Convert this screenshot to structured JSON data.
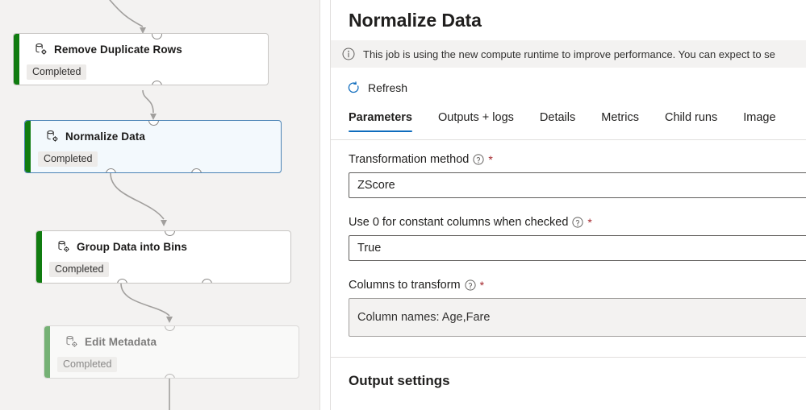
{
  "canvas": {
    "nodes": [
      {
        "id": "remove-duplicate-rows",
        "title": "Remove Duplicate Rows",
        "status": "Completed",
        "icon": "database-gear-icon",
        "accent_color": "#107c10",
        "selected": false,
        "faded": false
      },
      {
        "id": "normalize-data",
        "title": "Normalize Data",
        "status": "Completed",
        "icon": "database-gear-icon",
        "accent_color": "#107c10",
        "selected": true,
        "faded": false
      },
      {
        "id": "group-data-into-bins",
        "title": "Group Data into Bins",
        "status": "Completed",
        "icon": "database-gear-icon",
        "accent_color": "#107c10",
        "selected": false,
        "faded": false
      },
      {
        "id": "edit-metadata",
        "title": "Edit Metadata",
        "status": "Completed",
        "icon": "database-gear-icon",
        "accent_color": "#107c10",
        "selected": false,
        "faded": true
      }
    ]
  },
  "panel": {
    "title": "Normalize Data",
    "info": {
      "icon": "info-circle-icon",
      "text": "This job is using the new compute runtime to improve performance. You can expect to se"
    },
    "command_bar": {
      "refresh_icon": "refresh-icon",
      "refresh_label": "Refresh"
    },
    "tabs": [
      {
        "label": "Parameters",
        "active": true
      },
      {
        "label": "Outputs + logs",
        "active": false
      },
      {
        "label": "Details",
        "active": false
      },
      {
        "label": "Metrics",
        "active": false
      },
      {
        "label": "Child runs",
        "active": false
      },
      {
        "label": "Image",
        "active": false
      }
    ],
    "accent_color": "#0f6cbd",
    "required_marker": "*",
    "fields": [
      {
        "label": "Transformation method",
        "value": "ZScore",
        "required": true,
        "help_icon": "help-circle-icon",
        "readonly": false
      },
      {
        "label": "Use 0 for constant columns when checked",
        "value": "True",
        "required": true,
        "help_icon": "help-circle-icon",
        "readonly": false
      },
      {
        "label": "Columns to transform",
        "value": "Column names: Age,Fare",
        "required": true,
        "help_icon": "help-circle-icon",
        "readonly": true
      }
    ],
    "output_settings_heading": "Output settings"
  }
}
